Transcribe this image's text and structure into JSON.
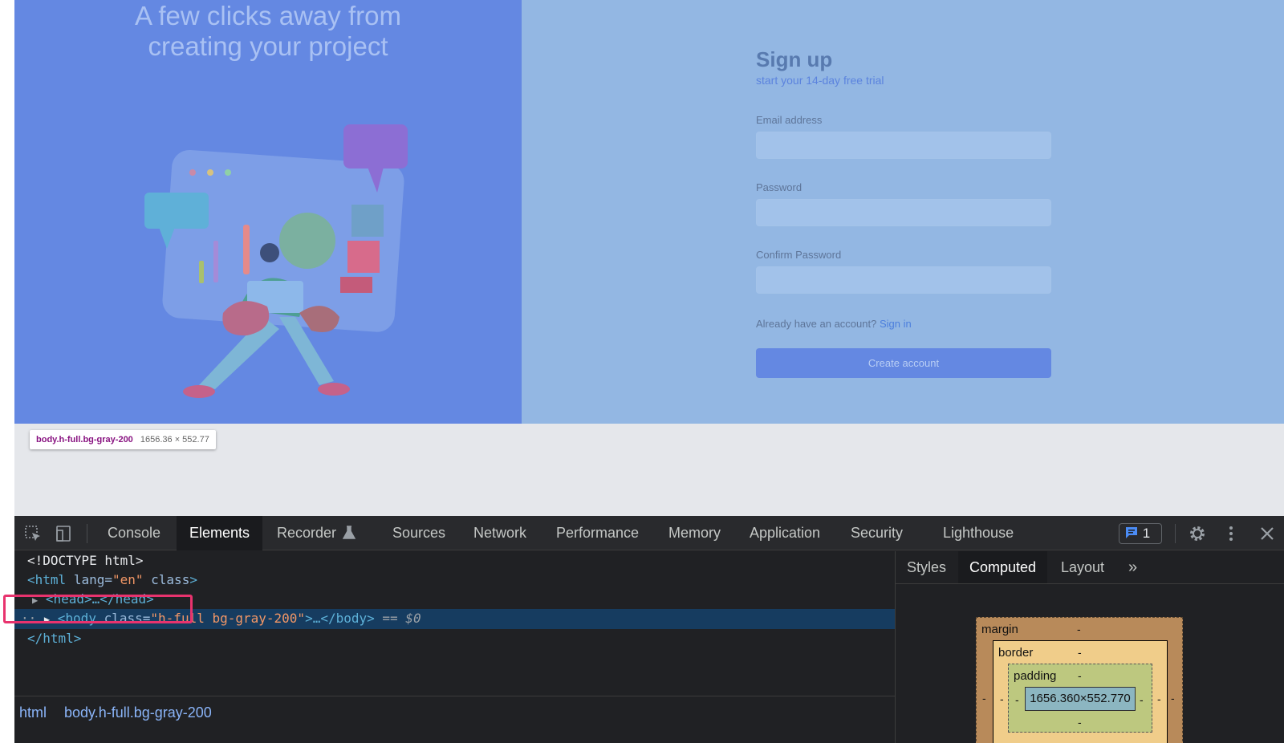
{
  "page": {
    "hero_title_line1": "A few clicks away from",
    "hero_title_line2": "creating your project",
    "signup_title": "Sign up",
    "signup_subtitle": "start your 14-day free trial",
    "email_label": "Email address",
    "password_label": "Password",
    "confirm_password_label": "Confirm Password",
    "account_prompt": "Already have an account?",
    "signin_link": "Sign in",
    "create_account_button": "Create account"
  },
  "tooltip": {
    "selector": "body.h-full.bg-gray-200",
    "size": "1656.36 × 552.77"
  },
  "devtools": {
    "tabs": [
      "Console",
      "Elements",
      "Recorder",
      "Sources",
      "Network",
      "Performance",
      "Memory",
      "Application",
      "Security",
      "Lighthouse"
    ],
    "active_tab": "Elements",
    "issues_count": "1",
    "dom": {
      "doctype": "<!DOCTYPE html>",
      "html_open_tag": "<html",
      "html_attr_lang": "lang",
      "html_attr_lang_eq": "=",
      "html_attr_lang_val": "\"en\"",
      "html_attr_class": "class",
      "html_open_close": ">",
      "head_line": "<head>…</head>",
      "body_prefix": "<body",
      "body_attr_class": "class",
      "body_eq": "=",
      "body_attr_val": "\"h-full bg-gray-200\"",
      "body_suffix": ">…</body>",
      "eq_dollar": "== $0",
      "html_close": "</html>"
    },
    "breadcrumbs": [
      "html",
      "body.h-full.bg-gray-200"
    ],
    "side_tabs": [
      "Styles",
      "Computed",
      "Layout"
    ],
    "side_active_tab": "Computed",
    "box_model": {
      "margin_label": "margin",
      "border_label": "border",
      "padding_label": "padding",
      "content_size": "1656.360×552.770",
      "dash": "-"
    }
  },
  "colors": {
    "left_panel": "#6488e2",
    "right_panel": "#93b7e3",
    "selection_highlight": "#e8336e"
  }
}
